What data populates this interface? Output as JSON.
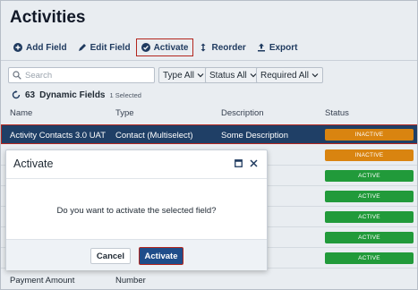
{
  "page": {
    "title": "Activities"
  },
  "toolbar": {
    "add_field": "Add Field",
    "edit_field": "Edit Field",
    "activate": "Activate",
    "reorder": "Reorder",
    "export": "Export"
  },
  "filters": {
    "search_placeholder": "Search",
    "type": "Type All",
    "status": "Status All",
    "required": "Required All"
  },
  "summary": {
    "count": "63",
    "label": "Dynamic Fields",
    "selected": "1 Selected"
  },
  "table": {
    "headers": {
      "name": "Name",
      "type": "Type",
      "description": "Description",
      "status": "Status"
    },
    "rows": [
      {
        "name": "Activity Contacts 3.0 UAT",
        "type": "Contact (Multiselect)",
        "description": "Some Description",
        "status": "INACTIVE"
      },
      {
        "name": "",
        "type": "",
        "description": "",
        "status": "INACTIVE"
      },
      {
        "name": "",
        "type": "",
        "description": "",
        "status": "ACTIVE"
      },
      {
        "name": "",
        "type": "",
        "description": "",
        "status": "ACTIVE"
      },
      {
        "name": "",
        "type": "",
        "description": "",
        "status": "ACTIVE"
      },
      {
        "name": "",
        "type": "",
        "description": "",
        "status": "ACTIVE"
      },
      {
        "name": "",
        "type": "",
        "description": "",
        "status": "ACTIVE"
      },
      {
        "name": "Payment Amount",
        "type": "Number",
        "description": "",
        "status": ""
      }
    ]
  },
  "modal": {
    "title": "Activate",
    "message": "Do you want to activate the selected field?",
    "cancel": "Cancel",
    "confirm": "Activate"
  },
  "colors": {
    "accent": "#1f4d8a",
    "selected_row": "#1f3f66",
    "highlight_border": "#b3261e",
    "inactive": "#d98410",
    "active": "#219a3a"
  }
}
